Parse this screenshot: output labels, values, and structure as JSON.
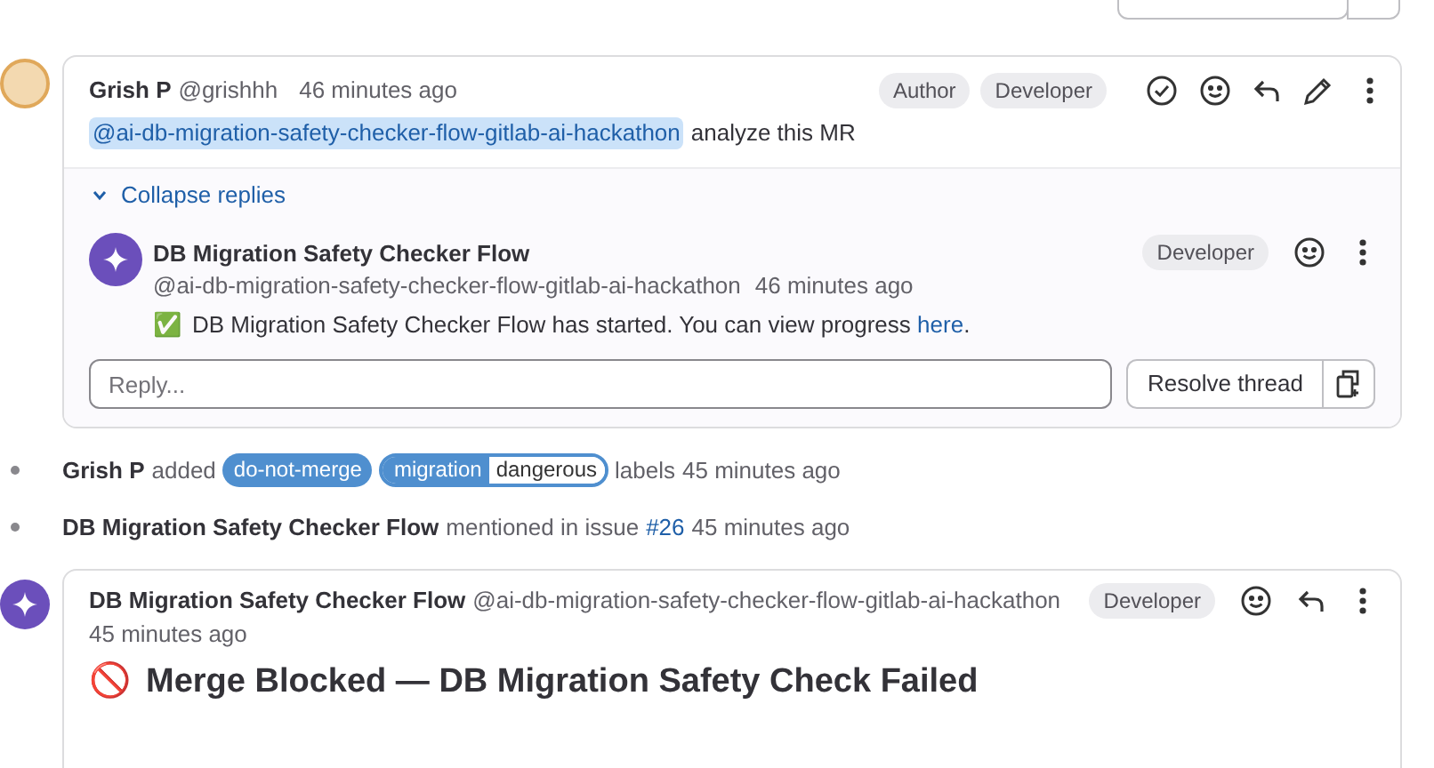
{
  "thread": {
    "author": "Grish P",
    "handle": "@grishhh",
    "time": "46 minutes ago",
    "badges": [
      "Author",
      "Developer"
    ],
    "mention": "@ai-db-migration-safety-checker-flow-gitlab-ai-hackathon",
    "text": "analyze this MR",
    "collapse": "Collapse replies",
    "reply": {
      "author": "DB Migration Safety Checker Flow",
      "handle": "@ai-db-migration-safety-checker-flow-gitlab-ai-hackathon",
      "time": "46 minutes ago",
      "badge": "Developer",
      "emoji": "✅",
      "text": "DB Migration Safety Checker Flow has started. You can view progress ",
      "link": "here",
      "after": "."
    },
    "reply_placeholder": "Reply...",
    "resolve": "Resolve thread"
  },
  "events": [
    {
      "kind": "labels",
      "author": "Grish P",
      "verb": "added",
      "labels": [
        {
          "name": "do-not-merge"
        },
        {
          "name": "migration",
          "scope": "dangerous"
        }
      ],
      "suffix": "labels",
      "time": "45 minutes ago"
    },
    {
      "kind": "mention",
      "author": "DB Migration Safety Checker Flow",
      "verb": "mentioned in issue",
      "link": "#26",
      "time": "45 minutes ago"
    }
  ],
  "note": {
    "author": "DB Migration Safety Checker Flow",
    "handle": "@ai-db-migration-safety-checker-flow-gitlab-ai-hackathon",
    "time": "45 minutes ago",
    "badge": "Developer",
    "title_emoji": "🚫",
    "title": "Merge Blocked — DB Migration Safety Check Failed"
  }
}
